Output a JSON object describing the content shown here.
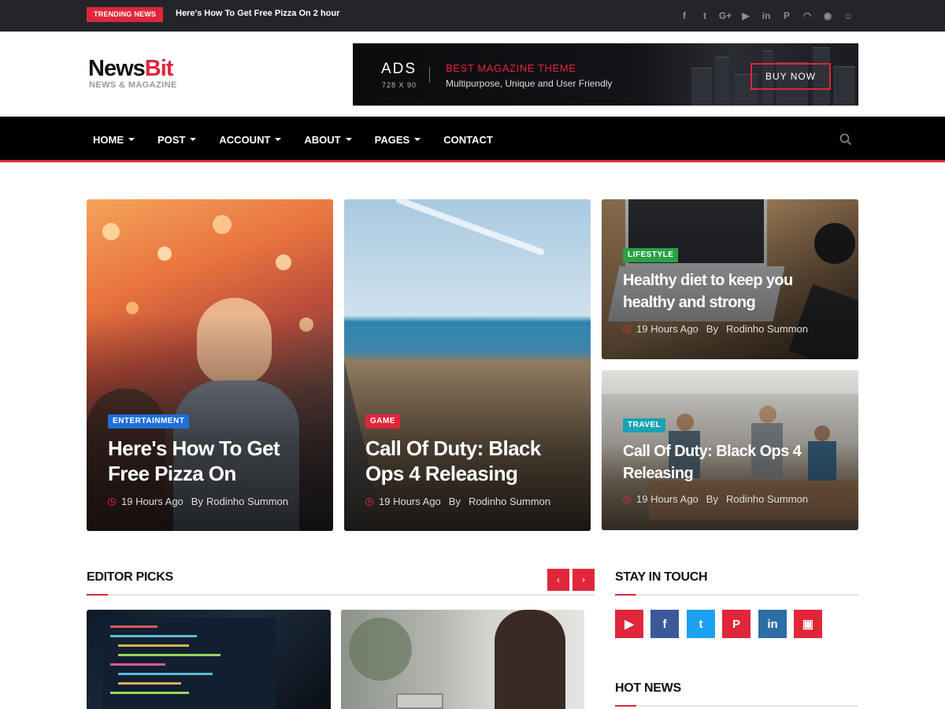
{
  "topbar": {
    "trending_badge": "TRENDING NEWS",
    "trending_text": "Here's How To Get Free Pizza On 2 hour",
    "social_icons": [
      "facebook-icon",
      "twitter-icon",
      "google-plus-icon",
      "youtube-icon",
      "linkedin-icon",
      "pinterest-icon",
      "rss-icon",
      "github-icon",
      "reddit-icon"
    ],
    "social_glyphs": [
      "f",
      "t",
      "G+",
      "▶",
      "in",
      "P",
      "◠",
      "◉",
      "☺"
    ]
  },
  "logo": {
    "main_a": "News",
    "main_b": "Bit",
    "sub": "NEWS & MAGAZINE"
  },
  "ad": {
    "title": "ADS",
    "size": "728 X 90",
    "headline": "BEST MAGAZINE THEME",
    "description": "Multipurpose, Unique and User Friendly",
    "button": "BUY NOW"
  },
  "nav": {
    "items": [
      {
        "label": "HOME",
        "dropdown": true
      },
      {
        "label": "POST",
        "dropdown": true
      },
      {
        "label": "ACCOUNT",
        "dropdown": true
      },
      {
        "label": "ABOUT",
        "dropdown": true
      },
      {
        "label": "PAGES",
        "dropdown": true
      },
      {
        "label": "CONTACT",
        "dropdown": false
      }
    ],
    "search_icon": "search-icon"
  },
  "featured": [
    {
      "tag": "ENTERTAINMENT",
      "tag_color": "#1e6fd9",
      "title_line1": "Here's How To Get",
      "title_line2": "Free Pizza On",
      "time": "19 Hours Ago",
      "by": "By",
      "author": "Rodinho Summon"
    },
    {
      "tag": "GAME",
      "tag_color": "#e0263a",
      "title_line1": "Call Of Duty: Black",
      "title_line2": "Ops 4 Releasing",
      "time": "19 Hours Ago",
      "by": "By",
      "author": "Rodinho Summon"
    },
    {
      "tag": "LIFESTYLE",
      "tag_color": "#2aa146",
      "title_line1": "Healthy diet to keep you",
      "title_line2": "healthy and strong",
      "time": "19 Hours Ago",
      "by": "By",
      "author": "Rodinho Summon"
    },
    {
      "tag": "TRAVEL",
      "tag_color": "#1aa3b5",
      "title_line1": "Call Of Duty: Black Ops 4",
      "title_line2": "Releasing",
      "time": "19 Hours Ago",
      "by": "By",
      "author": "Rodinho Summon"
    }
  ],
  "editor_picks": {
    "title": "EDITOR PICKS",
    "prev": "‹",
    "next": "›"
  },
  "stay_in_touch": {
    "title": "STAY IN TOUCH",
    "icons": [
      {
        "name": "youtube-icon",
        "glyph": "▶",
        "color": "#e0263a"
      },
      {
        "name": "facebook-icon",
        "glyph": "f",
        "color": "#3b5998"
      },
      {
        "name": "twitter-icon",
        "glyph": "t",
        "color": "#1da1f2"
      },
      {
        "name": "pinterest-icon",
        "glyph": "P",
        "color": "#e0263a"
      },
      {
        "name": "linkedin-icon",
        "glyph": "in",
        "color": "#2e6ea6"
      },
      {
        "name": "youtube-alt-icon",
        "glyph": "▣",
        "color": "#e0263a"
      }
    ]
  },
  "hot_news": {
    "title": "HOT NEWS"
  }
}
